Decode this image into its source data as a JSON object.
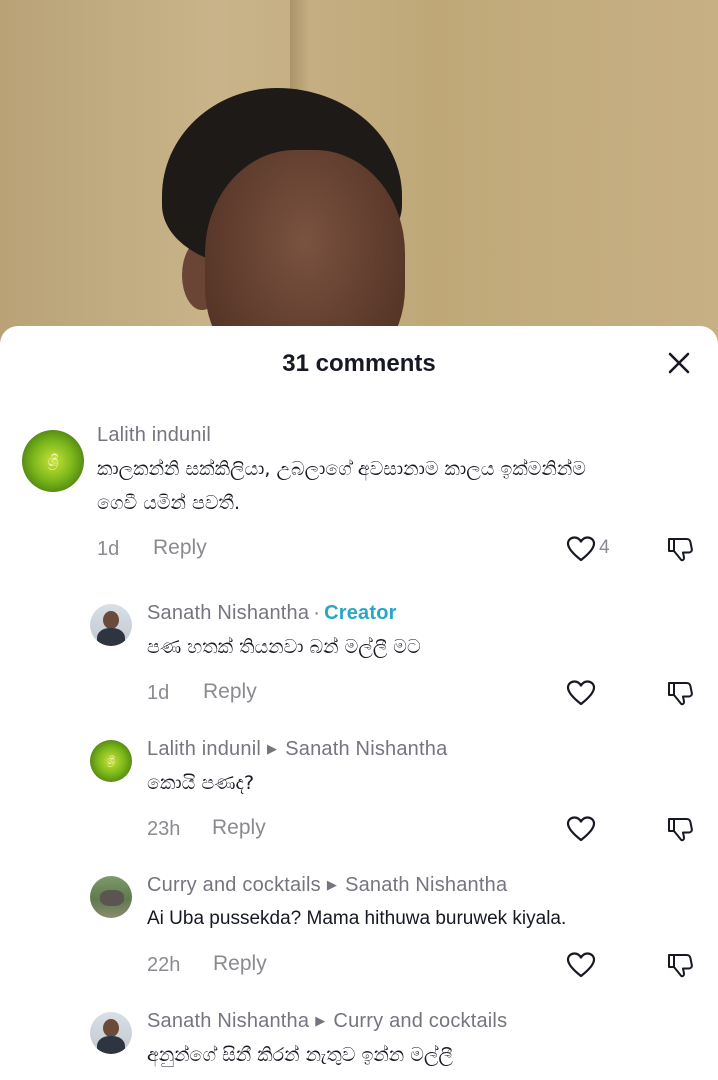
{
  "header": {
    "title": "31 comments"
  },
  "comments": [
    {
      "author": "Lalith  indunil",
      "text_line1": "කාලකන්නි සක්කිලියා, උබලාගේ අවසානාම කාලය ඉක්මනින්ම",
      "text_line2": "ගෙවී යමින් පවතී.",
      "time": "1d",
      "reply_label": "Reply",
      "likes": "4"
    },
    {
      "author": "Sanath Nishantha",
      "separator": "·",
      "badge": "Creator",
      "text_line1": "පණ හතක් තියනවා බන් මල්ලී මට",
      "time": "1d",
      "reply_label": "Reply"
    },
    {
      "author": "Lalith  indunil",
      "reply_to": "Sanath Nishantha",
      "text_line1": "කොයි පණද?",
      "time": "23h",
      "reply_label": "Reply"
    },
    {
      "author": "Curry and cocktails",
      "reply_to": "Sanath Nishantha",
      "text_line1": "Ai Uba pussekda? Mama hithuwa buruwek kiyala.",
      "time": "22h",
      "reply_label": "Reply"
    },
    {
      "author": "Sanath Nishantha",
      "reply_to": "Curry and cocktails",
      "text_line1": "අනුන්ගේ සිනී කිරන් නැතුව ඉන්න මල්ලී"
    }
  ],
  "icons": {
    "close": "close-icon",
    "like": "heart-outline-icon",
    "dislike": "thumbs-down-icon",
    "reply_arrow": "▶"
  },
  "colors": {
    "creator_badge": "#2aa6c6",
    "muted_text": "#8a8b91",
    "primary_text": "#161823"
  }
}
